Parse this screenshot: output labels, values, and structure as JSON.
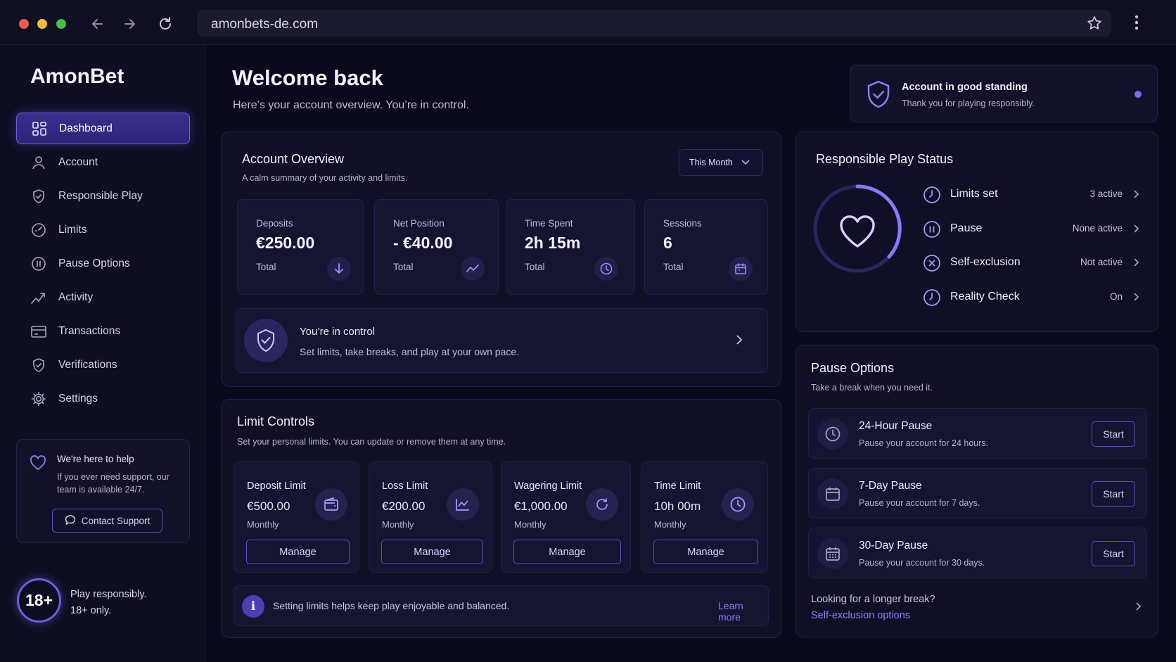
{
  "browser": {
    "url": "amonbets-de.com",
    "icons": [
      "back-arrow-icon",
      "forward-arrow-icon",
      "reload-icon",
      "star-icon",
      "kebab-menu-icon"
    ]
  },
  "sidebar": {
    "brand": "AmonBet",
    "items": [
      {
        "label": "Dashboard",
        "icon": "dashboard-grid-icon",
        "active": true
      },
      {
        "label": "Account",
        "icon": "user-icon"
      },
      {
        "label": "Responsible Play",
        "icon": "shield-check-icon"
      },
      {
        "label": "Limits",
        "icon": "gauge-icon"
      },
      {
        "label": "Pause Options",
        "icon": "pause-icon"
      },
      {
        "label": "Activity",
        "icon": "trend-line-icon"
      },
      {
        "label": "Transactions",
        "icon": "card-icon"
      },
      {
        "label": "Verifications",
        "icon": "shield-check-icon"
      },
      {
        "label": "Settings",
        "icon": "gear-icon"
      }
    ],
    "help": {
      "title": "We're here to help",
      "text": "If you ever need support, our team is available 24/7.",
      "button": "Contact Support"
    },
    "age": {
      "badge": "18+",
      "line1": "Play responsibly.",
      "line2": "18+ only."
    }
  },
  "header": {
    "title": "Welcome back",
    "subtitle": "Here’s your account overview. You’re in control."
  },
  "standing": {
    "title": "Account in good standing",
    "subtitle": "Thank you for playing responsibly."
  },
  "overview": {
    "title": "Account Overview",
    "subtitle": "A calm summary of your activity and limits.",
    "period": "This Month",
    "stats": [
      {
        "label": "Deposits",
        "value": "€250.00",
        "sub": "Total",
        "icon": "arrow-down-icon"
      },
      {
        "label": "Net Position",
        "value": "- €40.00",
        "sub": "Total",
        "icon": "trend-icon"
      },
      {
        "label": "Time Spent",
        "value": "2h 15m",
        "sub": "Total",
        "icon": "clock-icon"
      },
      {
        "label": "Sessions",
        "value": "6",
        "sub": "Total",
        "icon": "calendar-icon"
      }
    ],
    "control": {
      "title": "You’re in control",
      "subtitle": "Set limits, take breaks, and play at your own pace."
    }
  },
  "limits": {
    "title": "Limit Controls",
    "subtitle": "Set your personal limits. You can update or remove them at any time.",
    "items": [
      {
        "title": "Deposit Limit",
        "value": "€500.00",
        "period": "Monthly",
        "button": "Manage",
        "icon": "wallet-icon"
      },
      {
        "title": "Loss Limit",
        "value": "€200.00",
        "period": "Monthly",
        "button": "Manage",
        "icon": "chart-icon"
      },
      {
        "title": "Wagering Limit",
        "value": "€1,000.00",
        "period": "Monthly",
        "button": "Manage",
        "icon": "refresh-icon"
      },
      {
        "title": "Time Limit",
        "value": "10h 00m",
        "period": "Monthly",
        "button": "Manage",
        "icon": "clock-icon"
      }
    ],
    "info": "Setting limits helps keep play enjoyable and balanced.",
    "learn_more": "Learn more"
  },
  "responsible": {
    "title": "Responsible Play Status",
    "rows": [
      {
        "label": "Limits set",
        "value": "3 active",
        "icon": "clock-icon"
      },
      {
        "label": "Pause",
        "value": "None active",
        "icon": "pause-icon"
      },
      {
        "label": "Self-exclusion",
        "value": "Not active",
        "icon": "x-circle-icon"
      },
      {
        "label": "Reality Check",
        "value": "On",
        "icon": "clock-icon"
      }
    ]
  },
  "pause": {
    "title": "Pause Options",
    "subtitle": "Take a break when you need it.",
    "items": [
      {
        "title": "24-Hour Pause",
        "sub": "Pause your account for 24 hours.",
        "button": "Start",
        "icon": "clock-icon"
      },
      {
        "title": "7-Day Pause",
        "sub": "Pause your account for 7 days.",
        "button": "Start",
        "icon": "calendar-icon"
      },
      {
        "title": "30-Day Pause",
        "sub": "Pause your account for 30 days.",
        "button": "Start",
        "icon": "calendar-grid-icon"
      }
    ],
    "longer": "Looking for a longer break?",
    "self_exclusion_link": "Self-exclusion options"
  },
  "colors": {
    "accent": "#7e6cf5",
    "background": "#0b0a1c",
    "card": "#100f26",
    "link": "#8f7ff9"
  }
}
